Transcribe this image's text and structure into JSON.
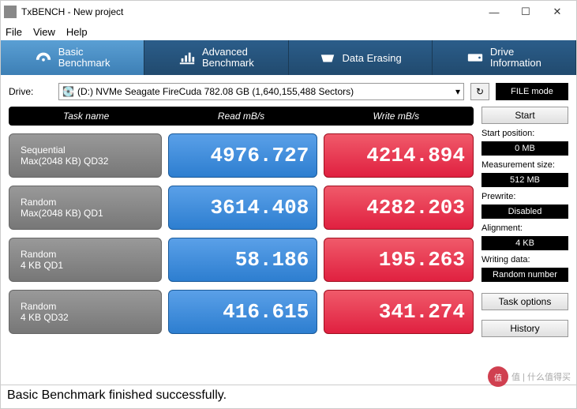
{
  "window": {
    "title": "TxBENCH - New project"
  },
  "menu": {
    "file": "File",
    "view": "View",
    "help": "Help"
  },
  "tabs": {
    "basic": "Basic\nBenchmark",
    "advanced": "Advanced\nBenchmark",
    "erasing": "Data Erasing",
    "drive": "Drive\nInformation"
  },
  "drive": {
    "label": "Drive:",
    "selected": "(D:) NVMe Seagate FireCuda  782.08 GB (1,640,155,488 Sectors)",
    "file_mode": "FILE mode"
  },
  "headers": {
    "task": "Task name",
    "read": "Read mB/s",
    "write": "Write mB/s"
  },
  "rows": [
    {
      "name1": "Sequential",
      "name2": "Max(2048 KB) QD32",
      "read": "4976.727",
      "write": "4214.894"
    },
    {
      "name1": "Random",
      "name2": "Max(2048 KB) QD1",
      "read": "3614.408",
      "write": "4282.203"
    },
    {
      "name1": "Random",
      "name2": "4 KB QD1",
      "read": "58.186",
      "write": "195.263"
    },
    {
      "name1": "Random",
      "name2": "4 KB QD32",
      "read": "416.615",
      "write": "341.274"
    }
  ],
  "side": {
    "start": "Start",
    "start_pos_lbl": "Start position:",
    "start_pos_val": "0 MB",
    "meas_lbl": "Measurement size:",
    "meas_val": "512 MB",
    "prewrite_lbl": "Prewrite:",
    "prewrite_val": "Disabled",
    "align_lbl": "Alignment:",
    "align_val": "4 KB",
    "writing_lbl": "Writing data:",
    "writing_val": "Random number",
    "task_opt": "Task options",
    "history": "History"
  },
  "status": "Basic Benchmark finished successfully.",
  "watermark": "值 | 什么值得买"
}
